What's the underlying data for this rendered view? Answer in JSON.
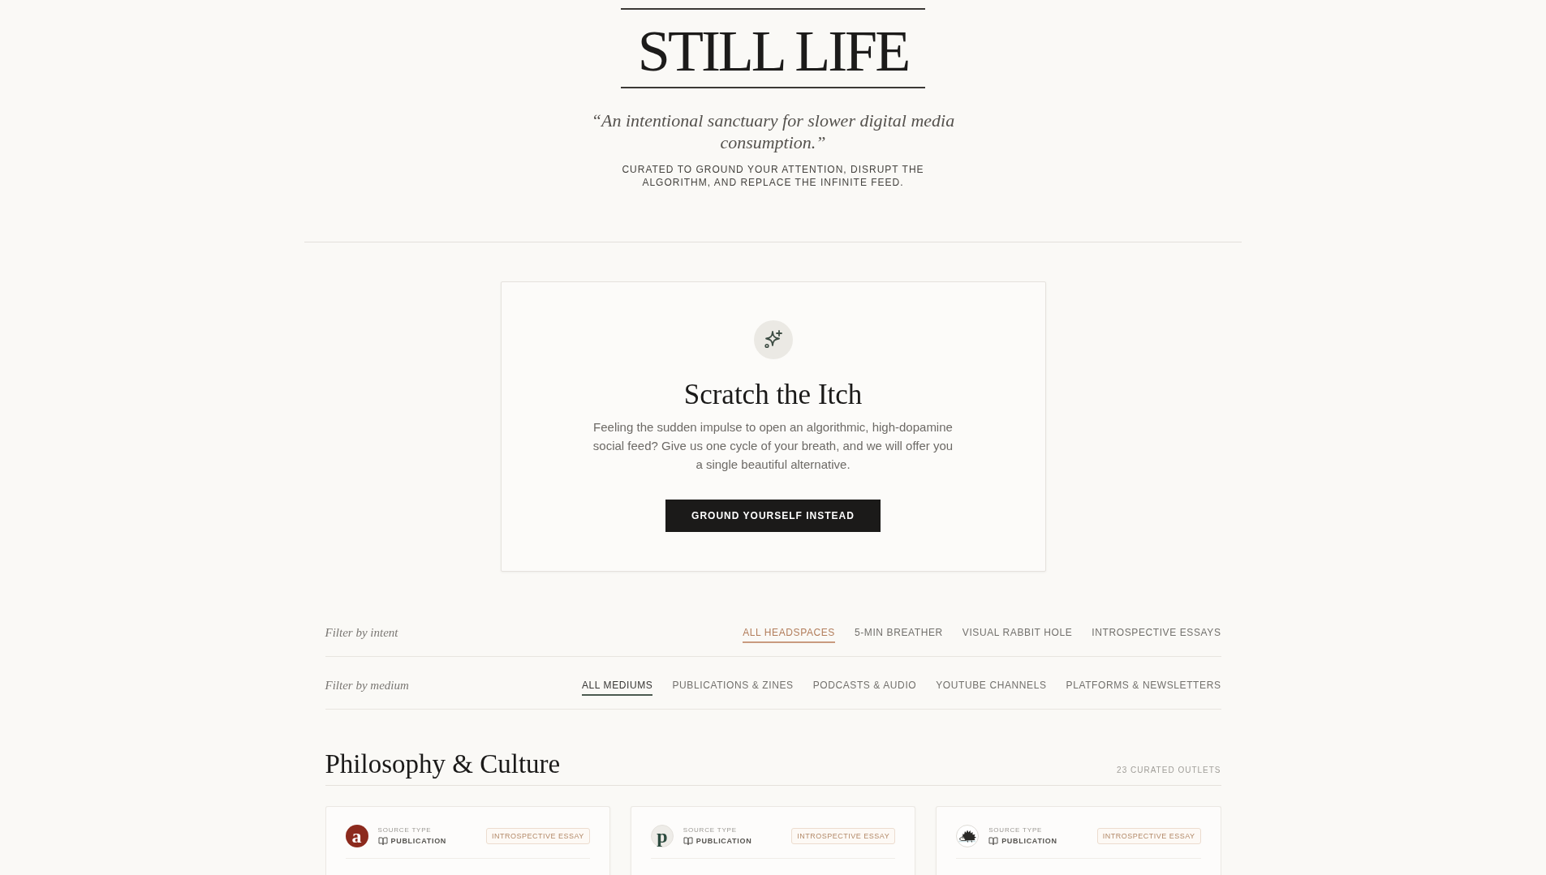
{
  "header": {
    "title": "STILL LIFE",
    "tagline": "“An intentional sanctuary for slower digital media consumption.”",
    "subtitle": "CURATED TO GROUND YOUR ATTENTION, DISRUPT THE ALGORITHM, AND REPLACE THE INFINITE FEED."
  },
  "prompt_card": {
    "title": "Scratch the Itch",
    "body": "Feeling the sudden impulse to open an algorithmic, high-dopamine social feed? Give us one cycle of your breath, and we will offer you a single beautiful alternative.",
    "button": "GROUND YOURSELF INSTEAD"
  },
  "filters": [
    {
      "kind": "intent",
      "label": "Filter by intent",
      "options": [
        {
          "label": "ALL HEADSPACES",
          "selected": true
        },
        {
          "label": "5-MIN BREATHER",
          "selected": false
        },
        {
          "label": "VISUAL RABBIT HOLE",
          "selected": false
        },
        {
          "label": "INTROSPECTIVE ESSAYS",
          "selected": false
        }
      ]
    },
    {
      "kind": "medium",
      "label": "Filter by medium",
      "options": [
        {
          "label": "ALL MEDIUMS",
          "selected": true
        },
        {
          "label": "PUBLICATIONS & ZINES",
          "selected": false
        },
        {
          "label": "PODCASTS & AUDIO",
          "selected": false
        },
        {
          "label": "YOUTUBE CHANNELS",
          "selected": false
        },
        {
          "label": "PLATFORMS & NEWSLETTERS",
          "selected": false
        }
      ]
    }
  ],
  "section": {
    "title": "Philosophy & Culture",
    "count": "23 CURATED OUTLETS",
    "cards": [
      {
        "logo": {
          "kind": "filled",
          "letter": "a",
          "color": "#8c2a1d"
        },
        "source_label": "SOURCE TYPE",
        "source_type": "PUBLICATION",
        "tag": "INTROSPECTIVE ESSAY"
      },
      {
        "logo": {
          "kind": "tinted",
          "letter": "p",
          "color": "#2c4a3e"
        },
        "source_label": "SOURCE TYPE",
        "source_type": "PUBLICATION",
        "tag": "INTROSPECTIVE ESSAY"
      },
      {
        "logo": {
          "kind": "hedgehog"
        },
        "source_label": "SOURCE TYPE",
        "source_type": "PUBLICATION",
        "tag": "INTROSPECTIVE ESSAY"
      }
    ]
  }
}
